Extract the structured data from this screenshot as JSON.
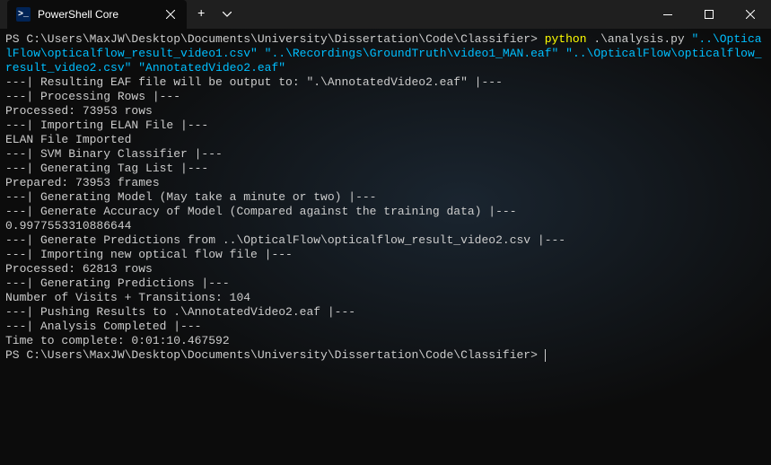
{
  "tab": {
    "title": "PowerShell Core"
  },
  "cmd": {
    "prompt1": "PS C:\\Users\\MaxJW\\Desktop\\Documents\\University\\Dissertation\\Code\\Classifier> ",
    "python": "python",
    "script": " .\\analysis.py ",
    "arg1": "\"..\\OpticalFlow\\opticalflow_result_video1.csv\"",
    "sp1": " ",
    "arg2": "\"..\\Recordings\\GroundTruth\\video1_MAN.eaf\"",
    "sp2": " ",
    "arg3": "\"..\\OpticalFlow\\opticalflow_result_video2.csv\"",
    "sp3": " ",
    "arg4": "\"AnnotatedVideo2.eaf\"",
    "prompt2": "PS C:\\Users\\MaxJW\\Desktop\\Documents\\University\\Dissertation\\Code\\Classifier> "
  },
  "out": {
    "l1": "---| Resulting EAF file will be output to: \".\\AnnotatedVideo2.eaf\" |---",
    "l2": "---| Processing Rows |---",
    "l3": "Processed: 73953 rows",
    "l4": "---| Importing ELAN File |---",
    "l5": "ELAN File Imported",
    "l6": "---| SVM Binary Classifier |---",
    "l7": "---| Generating Tag List |---",
    "l8": "Prepared: 73953 frames",
    "l9": "---| Generating Model (May take a minute or two) |---",
    "l10": "---| Generate Accuracy of Model (Compared against the training data) |---",
    "l11": "0.9977553310886644",
    "l12": "---| Generate Predictions from ..\\OpticalFlow\\opticalflow_result_video2.csv |---",
    "l13": "---| Importing new optical flow file |---",
    "l14": "Processed: 62813 rows",
    "l15": "---| Generating Predictions |---",
    "l16": "Number of Visits + Transitions: 104",
    "l17": "---| Pushing Results to .\\AnnotatedVideo2.eaf |---",
    "l18": "---| Analysis Completed |---",
    "l19": "Time to complete: 0:01:10.467592"
  }
}
